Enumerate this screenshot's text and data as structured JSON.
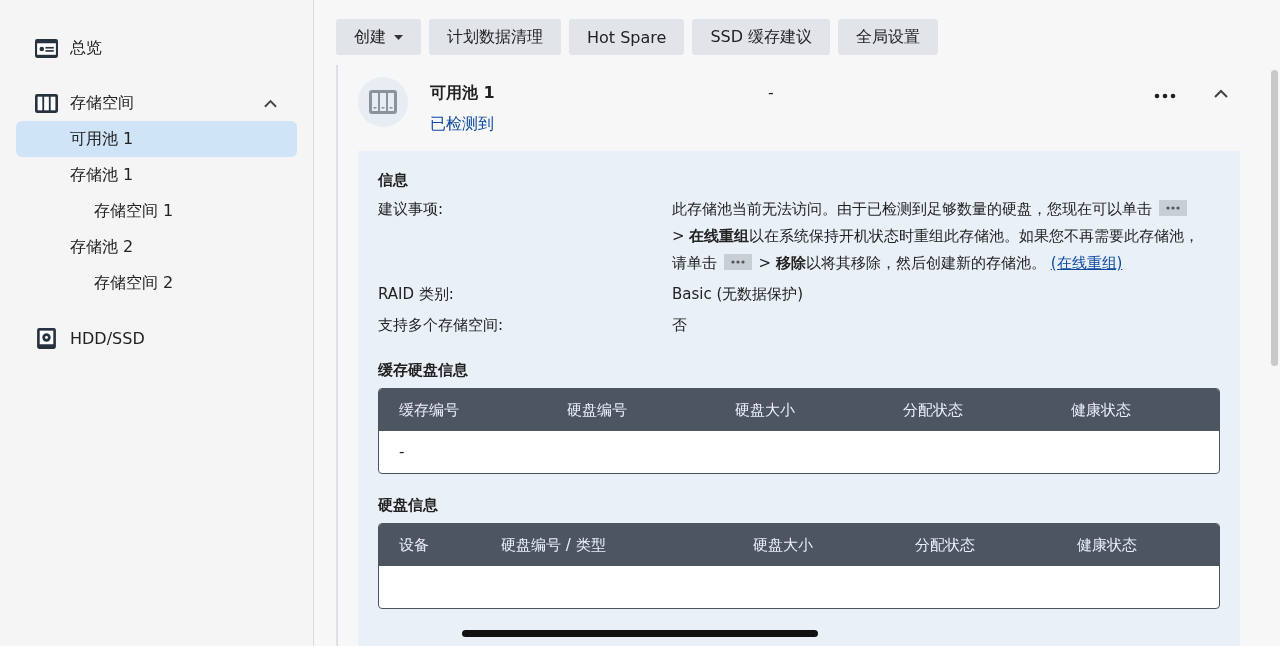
{
  "sidebar": {
    "items": [
      {
        "kind": "overview",
        "label": "总览",
        "selected": false
      },
      {
        "kind": "storage",
        "label": "存储空间",
        "selected": false,
        "expanded": true,
        "children": [
          {
            "label": "可用池 1",
            "selected": true
          },
          {
            "label": "存储池 1",
            "selected": false,
            "children": [
              {
                "label": "存储空间 1",
                "selected": false
              }
            ]
          },
          {
            "label": "存储池 2",
            "selected": false,
            "children": [
              {
                "label": "存储空间 2",
                "selected": false
              }
            ]
          }
        ]
      },
      {
        "kind": "disk",
        "label": "HDD/SSD",
        "selected": false
      }
    ]
  },
  "toolbar": {
    "buttons": [
      {
        "label": "创建",
        "dropdown": true
      },
      {
        "label": "计划数据清理",
        "dropdown": false
      },
      {
        "label": "Hot Spare",
        "dropdown": false
      },
      {
        "label": "SSD 缓存建议",
        "dropdown": false
      },
      {
        "label": "全局设置",
        "dropdown": false
      }
    ]
  },
  "pool": {
    "title": "可用池 1",
    "status": "已检测到",
    "middle": "-",
    "expanded": true,
    "info": {
      "heading": "信息",
      "rows": [
        {
          "label": "建议事项:",
          "parts": [
            {
              "kind": "text",
              "text": "此存储池当前无法访问。由于已检测到足够数量的硬盘，您现在可以单击 "
            },
            {
              "kind": "menu"
            },
            {
              "kind": "text",
              "text": " > **在线重组**以在系统保持开机状态时重组此存储池。如果您不再需要此存储池，请单击 "
            },
            {
              "kind": "menu"
            },
            {
              "kind": "text",
              "text": " > **移除**以将其移除，然后创建新的存储池。 "
            },
            {
              "kind": "link",
              "text": "(在线重组)"
            }
          ]
        },
        {
          "label": "RAID 类别:",
          "parts": [
            {
              "kind": "text",
              "text": "Basic (无数据保护)"
            }
          ]
        },
        {
          "label": "支持多个存储空间:",
          "parts": [
            {
              "kind": "text",
              "text": "否"
            }
          ]
        }
      ]
    },
    "tables": [
      {
        "heading": "缓存硬盘信息",
        "columns": [
          "缓存编号",
          "硬盘编号",
          "硬盘大小",
          "分配状态",
          "健康状态"
        ],
        "rows": [
          [
            "-"
          ]
        ]
      },
      {
        "heading": "硬盘信息",
        "columns": [
          "设备",
          "硬盘编号 / 类型",
          "硬盘大小",
          "分配状态",
          "健康状态"
        ]
      }
    ]
  }
}
